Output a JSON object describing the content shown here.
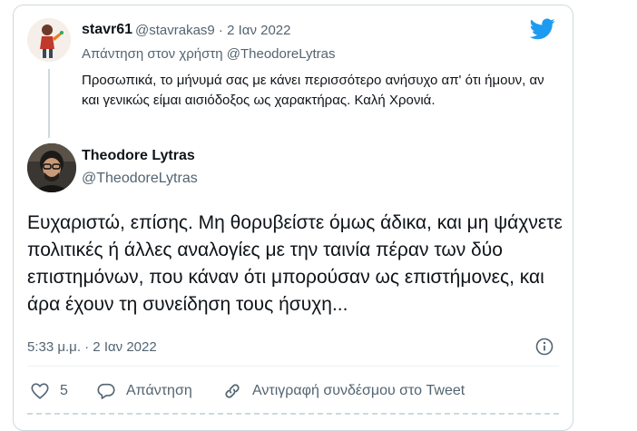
{
  "reply_tweet": {
    "display_name": "stavr61",
    "meta": "@stavrakas9 · 2 Ιαν 2022",
    "replying_to": "Απάντηση στον χρήστη @TheodoreLytras",
    "text": "Προσωπικά, το μήνυμά σας με κάνει περισσότερο ανήσυχο απ' ότι ήμουν, αν και γενικώς είμαι αισιόδοξος ως χαρακτήρας. Καλή Χρονιά."
  },
  "main_tweet": {
    "display_name": "Theodore Lytras",
    "handle": "@TheodoreLytras",
    "text": "Ευχαριστώ, επίσης. Μη θορυβείστε όμως άδικα, και μη ψάχνετε πολιτικές ή άλλες αναλογίες με την ταινία πέραν των δύο επιστημόνων, που κάναν ότι μπορούσαν ως επιστήμονες, και άρα έχουν τη συνείδηση τους ήσυχη...",
    "timestamp": "5:33 μ.μ. · 2 Ιαν 2022"
  },
  "actions": {
    "likes_count": "5",
    "reply_label": "Απάντηση",
    "copy_link_label": "Αντιγραφή συνδέσμου στο Tweet"
  },
  "colors": {
    "brand": "#1d9bf0",
    "secondary_text": "#536471",
    "border": "#cfd9de"
  },
  "icons": {
    "brand": "twitter-bird-icon",
    "info": "info-icon",
    "like": "heart-icon",
    "reply": "speech-bubble-icon",
    "copy": "link-icon"
  }
}
